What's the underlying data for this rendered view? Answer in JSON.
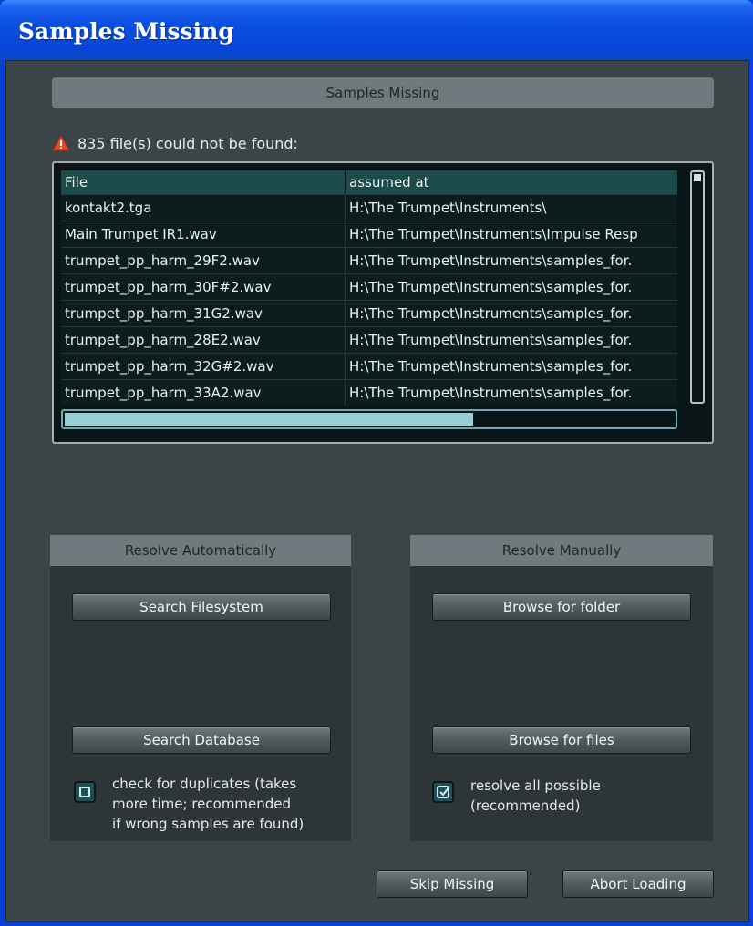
{
  "window": {
    "title": "Samples Missing"
  },
  "header": {
    "title": "Samples Missing"
  },
  "warning": {
    "icon": "warning-icon",
    "text": "835 file(s) could not be found:"
  },
  "table": {
    "columns": [
      "File",
      "assumed at"
    ],
    "rows": [
      [
        "kontakt2.tga",
        "H:\\The Trumpet\\Instruments\\"
      ],
      [
        "Main Trumpet IR1.wav",
        "H:\\The Trumpet\\Instruments\\Impulse Resp"
      ],
      [
        "trumpet_pp_harm_29F2.wav",
        "H:\\The Trumpet\\Instruments\\samples_for."
      ],
      [
        "trumpet_pp_harm_30F#2.wav",
        "H:\\The Trumpet\\Instruments\\samples_for."
      ],
      [
        "trumpet_pp_harm_31G2.wav",
        "H:\\The Trumpet\\Instruments\\samples_for."
      ],
      [
        "trumpet_pp_harm_28E2.wav",
        "H:\\The Trumpet\\Instruments\\samples_for."
      ],
      [
        "trumpet_pp_harm_32G#2.wav",
        "H:\\The Trumpet\\Instruments\\samples_for."
      ],
      [
        "trumpet_pp_harm_33A2.wav",
        "H:\\The Trumpet\\Instruments\\samples_for."
      ]
    ],
    "hscroll_fraction": 0.67
  },
  "auto": {
    "title": "Resolve Automatically",
    "search_filesystem": "Search Filesystem",
    "search_database": "Search Database",
    "duplicates_checked": false,
    "duplicates_label": [
      "check for duplicates (takes",
      "more time; recommended",
      "if wrong samples are found)"
    ]
  },
  "manual": {
    "title": "Resolve Manually",
    "browse_folder": "Browse for folder",
    "browse_files": "Browse for files",
    "resolve_all_checked": true,
    "resolve_all_label": [
      "resolve all possible",
      "(recommended)"
    ]
  },
  "footer": {
    "skip_missing": "Skip Missing",
    "abort_loading": "Abort Loading"
  },
  "colors": {
    "warning": "#e8482a",
    "panel_bg": "#3b4446",
    "header_bg": "#6e7a7d"
  }
}
